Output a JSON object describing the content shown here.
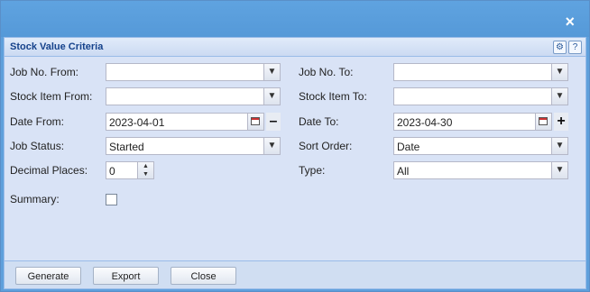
{
  "window": {
    "title": "Stock Value Criteria",
    "close_icon": "×"
  },
  "header_tools": {
    "gear": "⚙",
    "help": "?"
  },
  "fields": {
    "job_no_from": {
      "label": "Job No. From:",
      "value": ""
    },
    "job_no_to": {
      "label": "Job No. To:",
      "value": ""
    },
    "stock_item_from": {
      "label": "Stock Item From:",
      "value": ""
    },
    "stock_item_to": {
      "label": "Stock Item To:",
      "value": ""
    },
    "date_from": {
      "label": "Date From:",
      "value": "2023-04-01"
    },
    "date_to": {
      "label": "Date To:",
      "value": "2023-04-30"
    },
    "job_status": {
      "label": "Job Status:",
      "value": "Started"
    },
    "sort_order": {
      "label": "Sort Order:",
      "value": "Date"
    },
    "decimal_places": {
      "label": "Decimal Places:",
      "value": "0"
    },
    "type": {
      "label": "Type:",
      "value": "All"
    },
    "summary": {
      "label": "Summary:",
      "checked": false
    }
  },
  "glyphs": {
    "dropdown": "▼",
    "minus": "–",
    "plus": "+",
    "up": "▲",
    "down": "▼"
  },
  "buttons": {
    "generate": "Generate",
    "export": "Export",
    "close": "Close"
  }
}
